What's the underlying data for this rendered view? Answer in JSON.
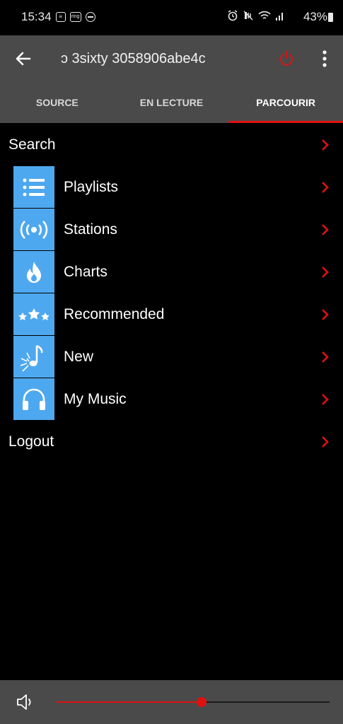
{
  "status_bar": {
    "time": "15:34",
    "battery": "43%",
    "icons": [
      "message-icon",
      "ring-icon",
      "do-not-disturb-icon",
      "alarm-icon",
      "mute-icon",
      "wifi-icon",
      "signal-icon",
      "battery-icon"
    ]
  },
  "app_bar": {
    "title": "ɔ 3sixty 3058906abe4c"
  },
  "tabs": [
    {
      "label": "SOURCE",
      "active": false
    },
    {
      "label": "EN LECTURE",
      "active": false
    },
    {
      "label": "PARCOURIR",
      "active": true
    }
  ],
  "browse": {
    "search_label": "Search",
    "items": [
      {
        "label": "Playlists",
        "icon": "list-icon"
      },
      {
        "label": "Stations",
        "icon": "radio-icon"
      },
      {
        "label": "Charts",
        "icon": "flame-icon"
      },
      {
        "label": "Recommended",
        "icon": "stars-icon"
      },
      {
        "label": "New",
        "icon": "music-note-icon"
      },
      {
        "label": "My Music",
        "icon": "headphones-icon"
      }
    ],
    "logout_label": "Logout"
  },
  "volume": {
    "level": 0.53
  },
  "colors": {
    "accent": "#e01010",
    "icon_tile": "#4ea8ef",
    "bar_background": "#4a4a4a"
  }
}
